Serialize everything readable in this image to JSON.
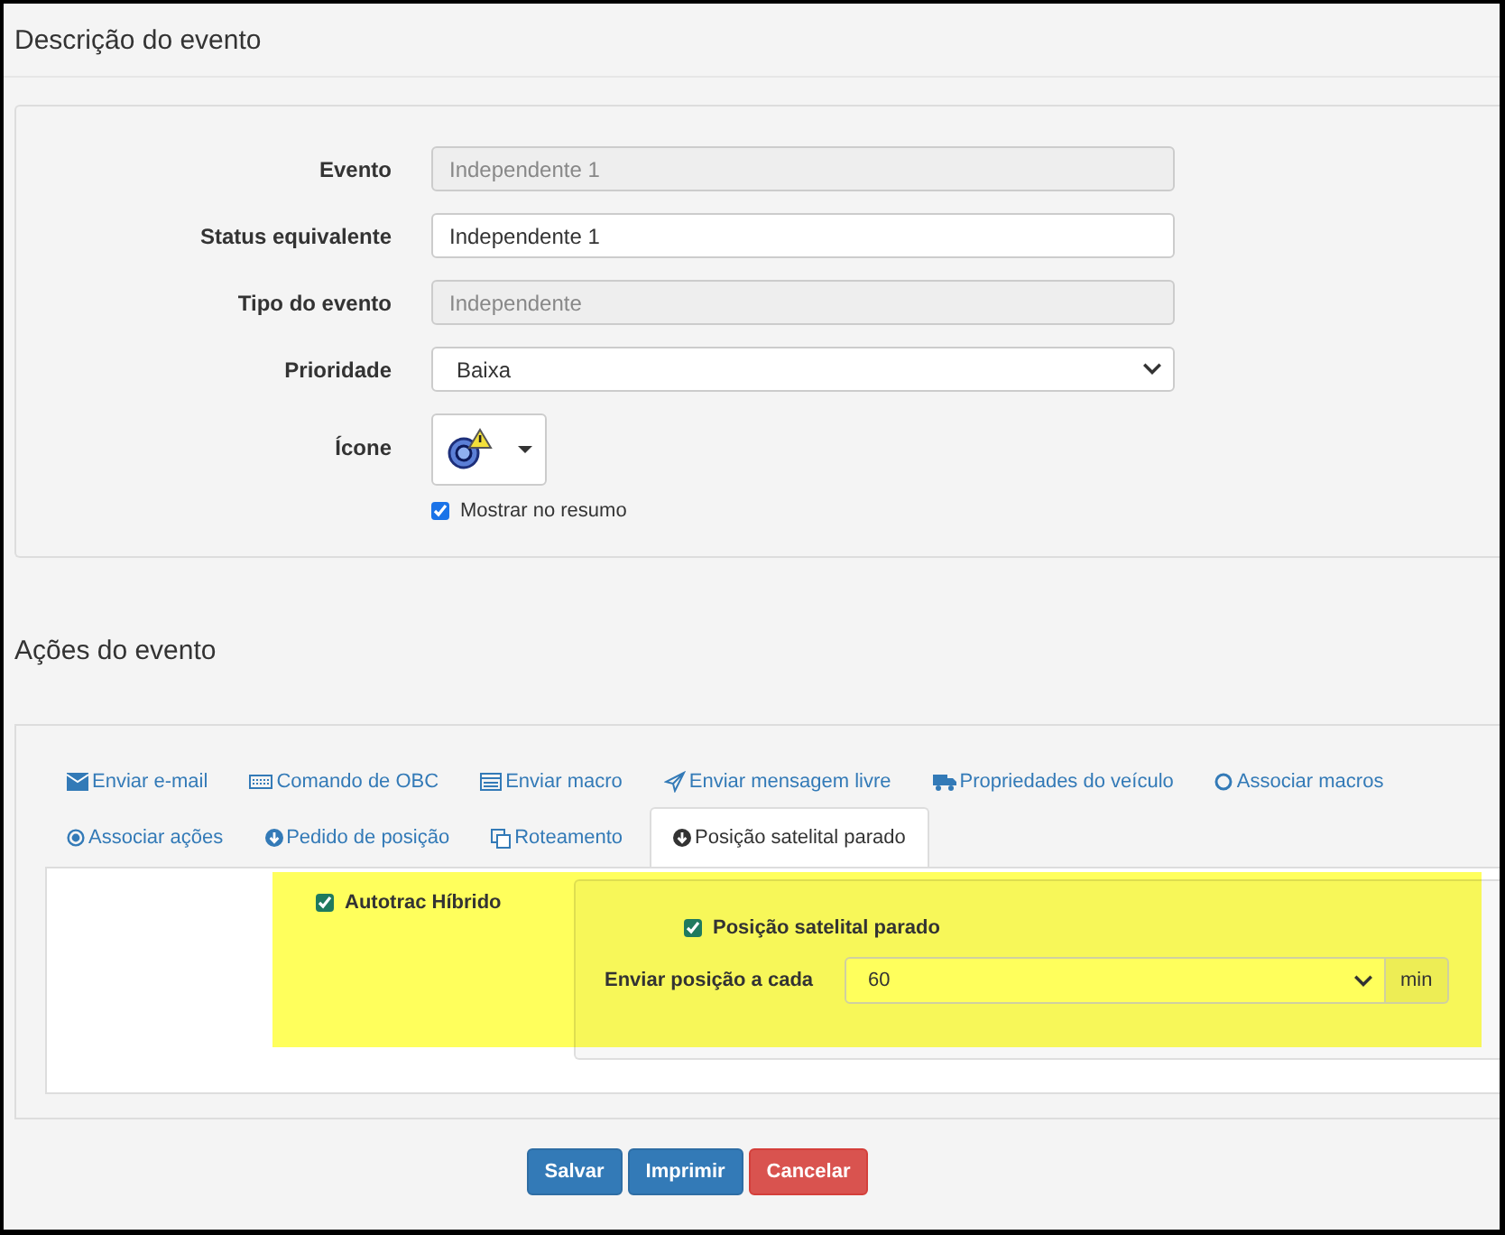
{
  "event_description": {
    "title": "Descrição do evento",
    "fields": [
      {
        "kind": "readonly",
        "label": "Evento",
        "value": "Independente 1"
      },
      {
        "kind": "text",
        "label": "Status equivalente",
        "value": "Independente 1"
      },
      {
        "kind": "readonly",
        "label": "Tipo do evento",
        "value": "Independente"
      },
      {
        "kind": "select",
        "label": "Prioridade",
        "value": "Baixa"
      },
      {
        "kind": "icon",
        "label": "Ícone"
      }
    ],
    "show_in_summary": {
      "label": "Mostrar no resumo",
      "checked": true
    }
  },
  "event_actions": {
    "title": "Ações do evento",
    "tab_rows": [
      [
        {
          "kind": "envelope",
          "label": "Enviar e-mail",
          "selected": false
        },
        {
          "kind": "keyboard",
          "label": "Comando de OBC",
          "selected": false
        },
        {
          "kind": "card",
          "label": "Enviar macro",
          "selected": false
        },
        {
          "kind": "plane",
          "label": "Enviar mensagem livre",
          "selected": false
        },
        {
          "kind": "truck",
          "label": "Propriedades do veículo",
          "selected": false
        },
        {
          "kind": "circle",
          "label": "Associar macros",
          "selected": false
        }
      ],
      [
        {
          "kind": "radio",
          "label": "Associar ações",
          "selected": false
        },
        {
          "kind": "down",
          "label": "Pedido de posição",
          "selected": false
        },
        {
          "kind": "copy",
          "label": "Roteamento",
          "selected": false
        },
        {
          "kind": "down",
          "label": "Posição satelital parado",
          "selected": true
        }
      ]
    ],
    "hybrid": {
      "label": "Autotrac Híbrido",
      "checked": true
    },
    "stopped_position": {
      "label": "Posição satelital parado",
      "checked": true
    },
    "interval": {
      "label": "Enviar posição a cada",
      "value": "60",
      "unit": "min"
    }
  },
  "buttons": [
    {
      "kind": "primary",
      "label": "Salvar"
    },
    {
      "kind": "primary",
      "label": "Imprimir"
    },
    {
      "kind": "danger",
      "label": "Cancelar"
    }
  ]
}
